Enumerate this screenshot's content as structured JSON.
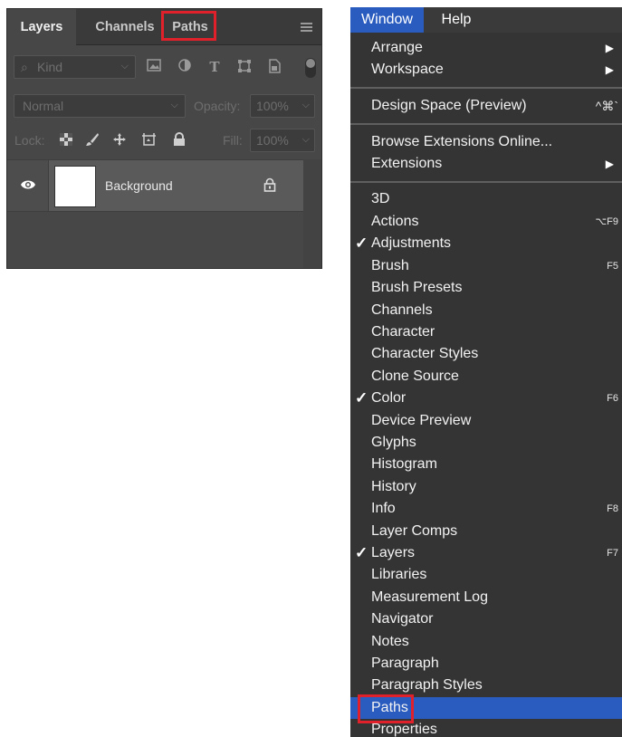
{
  "layers_panel": {
    "tabs": [
      {
        "label": "Layers",
        "active": true
      },
      {
        "label": "Channels",
        "active": false
      },
      {
        "label": "Paths",
        "active": false,
        "highlighted": true
      }
    ],
    "filter": {
      "kind_label": "Kind"
    },
    "blend_mode": "Normal",
    "opacity_label": "Opacity:",
    "opacity_value": "100%",
    "lock_label": "Lock:",
    "fill_label": "Fill:",
    "fill_value": "100%",
    "layers": [
      {
        "name": "Background",
        "visible": true,
        "locked": true
      }
    ]
  },
  "menubar": {
    "items": [
      {
        "label": "Window",
        "active": true
      },
      {
        "label": "Help",
        "active": false
      }
    ]
  },
  "window_menu": {
    "items": [
      {
        "label": "Arrange",
        "submenu": true
      },
      {
        "label": "Workspace",
        "submenu": true
      },
      {
        "label": "Design Space (Preview)",
        "shortcut": "^⌘`"
      },
      {
        "label": "Browse Extensions Online..."
      },
      {
        "label": "Extensions",
        "submenu": true
      },
      {
        "label": "3D"
      },
      {
        "label": "Actions",
        "shortcut": "⌥F9"
      },
      {
        "label": "Adjustments",
        "checked": true
      },
      {
        "label": "Brush",
        "shortcut": "F5"
      },
      {
        "label": "Brush Presets"
      },
      {
        "label": "Channels"
      },
      {
        "label": "Character"
      },
      {
        "label": "Character Styles"
      },
      {
        "label": "Clone Source"
      },
      {
        "label": "Color",
        "checked": true,
        "shortcut": "F6"
      },
      {
        "label": "Device Preview"
      },
      {
        "label": "Glyphs"
      },
      {
        "label": "Histogram"
      },
      {
        "label": "History"
      },
      {
        "label": "Info",
        "shortcut": "F8"
      },
      {
        "label": "Layer Comps"
      },
      {
        "label": "Layers",
        "checked": true,
        "shortcut": "F7"
      },
      {
        "label": "Libraries"
      },
      {
        "label": "Measurement Log"
      },
      {
        "label": "Navigator"
      },
      {
        "label": "Notes"
      },
      {
        "label": "Paragraph"
      },
      {
        "label": "Paragraph Styles"
      },
      {
        "label": "Paths",
        "selected": true,
        "highlighted": true
      },
      {
        "label": "Properties"
      }
    ]
  },
  "colors": {
    "highlight_box": "#e0202b",
    "menu_selection": "#2a5cc0",
    "panel_bg": "#474747",
    "menu_bg": "#343434"
  }
}
